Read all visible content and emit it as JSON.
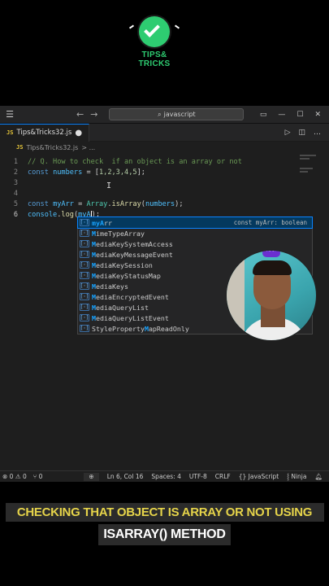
{
  "brand": {
    "line1": "TIPS&",
    "line2": "TRICKS",
    "color": "#2ecc71"
  },
  "titlebar": {
    "search": "javascript"
  },
  "tab": {
    "icon": "JS",
    "filename": "Tips&Tricks32.js"
  },
  "breadcrumb": {
    "icon": "JS",
    "file": "Tips&Tricks32.js",
    "rest": "> ..."
  },
  "code": {
    "ln1": "1",
    "ln2": "2",
    "ln3": "3",
    "ln4": "4",
    "ln5": "5",
    "ln6": "6",
    "l1_comment": "// Q. How to check  if an object is an array or not",
    "l2_kw": "const",
    "l2_var": "numbers",
    "l2_eq": " = [",
    "l2_nums": "1,2,3,4,5",
    "l2_end": "];",
    "l5_kw": "const",
    "l5_var": "myArr",
    "l5_eq": " = ",
    "l5_cls": "Array",
    "l5_dot": ".",
    "l5_fn": "isArray",
    "l5_open": "(",
    "l5_arg": "numbers",
    "l5_end": ");",
    "l6_obj": "console",
    "l6_dot": ".",
    "l6_fn": "log",
    "l6_open": "(",
    "l6_arg": "myA",
    "l6_end": ");"
  },
  "suggestions": [
    {
      "hl": "myA",
      "rest": "rr",
      "detail": "const myArr: boolean"
    },
    {
      "pre": "",
      "hl": "M",
      "rest": "imeTypeArray"
    },
    {
      "pre": "",
      "hl": "M",
      "rest": "ediaKeySystemAccess"
    },
    {
      "pre": "",
      "hl": "M",
      "rest": "ediaKeyMessageEvent"
    },
    {
      "pre": "",
      "hl": "M",
      "rest": "ediaKeySession"
    },
    {
      "pre": "",
      "hl": "M",
      "rest": "ediaKeyStatusMap"
    },
    {
      "pre": "",
      "hl": "M",
      "rest": "ediaKeys"
    },
    {
      "pre": "",
      "hl": "M",
      "rest": "ediaEncryptedEvent"
    },
    {
      "pre": "",
      "hl": "M",
      "rest": "ediaQueryList"
    },
    {
      "pre": "",
      "hl": "M",
      "rest": "ediaQueryListEvent"
    },
    {
      "pre": "StyleProperty",
      "hl": "M",
      "rest": "apReadOnly"
    }
  ],
  "status": {
    "errors": "0",
    "warnings": "0",
    "ports": "0",
    "position": "Ln 6, Col 16",
    "spaces": "Spaces: 4",
    "encoding": "UTF-8",
    "eol": "CRLF",
    "language": "JavaScript",
    "formatter": "Ninja"
  },
  "caption": {
    "line1": "CHECKING THAT  OBJECT IS ARRAY OR NOT USING",
    "line2": "ISARRAY() METHOD",
    "line1_color": "#e6d44a"
  }
}
